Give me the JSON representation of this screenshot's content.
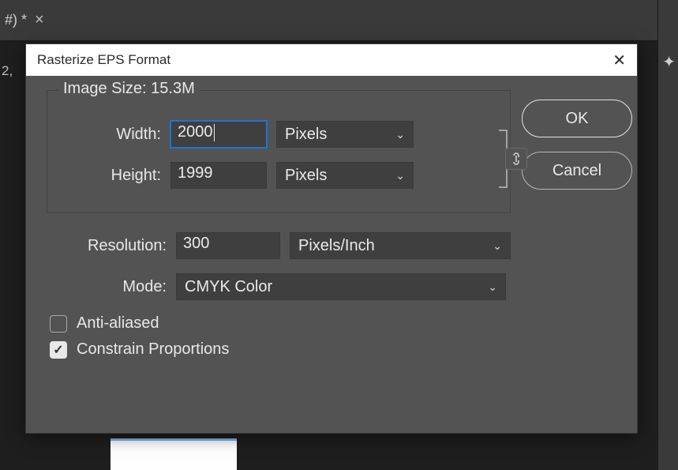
{
  "tab": {
    "label": "#) *",
    "close_glyph": "×"
  },
  "under_text": "2,",
  "right_icon": "✦",
  "dialog": {
    "title": "Rasterize EPS Format",
    "close_glyph": "✕",
    "ok": "OK",
    "cancel": "Cancel",
    "image_size": {
      "legend_prefix": "Image Size: ",
      "size": "15.3M"
    },
    "width": {
      "label": "Width:",
      "value": "2000",
      "unit": "Pixels"
    },
    "height": {
      "label": "Height:",
      "value": "1999",
      "unit": "Pixels"
    },
    "resolution": {
      "label": "Resolution:",
      "value": "300",
      "unit": "Pixels/Inch"
    },
    "mode": {
      "label": "Mode:",
      "value": "CMYK Color"
    },
    "antialiased": {
      "label": "Anti-aliased",
      "checked": false
    },
    "constrain": {
      "label": "Constrain Proportions",
      "checked": true
    },
    "link_glyph": "⛓"
  },
  "ui": {
    "chevron": "⌄",
    "check": "✓"
  }
}
